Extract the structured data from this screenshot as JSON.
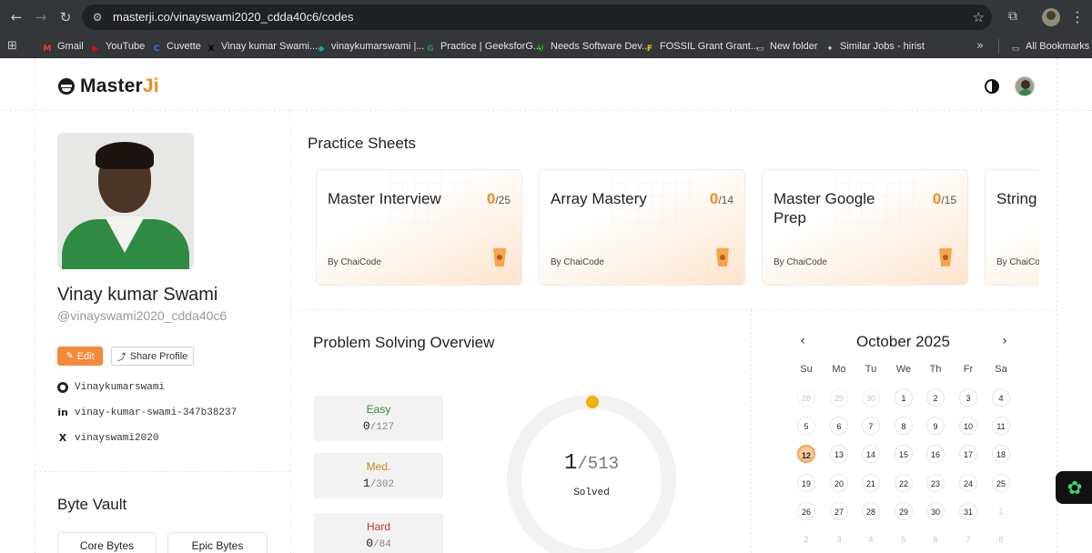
{
  "browser": {
    "url": "masterji.co/vinayswami2020_cdda40c6/codes",
    "bookmarks": [
      {
        "label": "Gmail",
        "icon": "gmail-icon",
        "color": "#ea4335",
        "glyph": "M"
      },
      {
        "label": "YouTube",
        "icon": "youtube-icon",
        "color": "#ff0000",
        "glyph": "▶"
      },
      {
        "label": "Cuvette",
        "icon": "cuvette-icon",
        "color": "#3d6cf0",
        "glyph": "C"
      },
      {
        "label": "Vinay kumar Swami...",
        "icon": "x-icon",
        "color": "#000000",
        "glyph": "X"
      },
      {
        "label": "vinaykumarswami |...",
        "icon": "diamond-icon",
        "color": "#16a7a0",
        "glyph": "◆"
      },
      {
        "label": "Practice | GeeksforG...",
        "icon": "gfg-icon",
        "color": "#2f8d46",
        "glyph": "G"
      },
      {
        "label": "Needs Software Dev...",
        "icon": "upwork-icon",
        "color": "#14a800",
        "glyph": "U"
      },
      {
        "label": "FOSSIL Grant Grant...",
        "icon": "fossil-icon",
        "color": "#f2c811",
        "glyph": "F"
      },
      {
        "label": "New folder",
        "icon": "folder-icon",
        "color": "#c8cacd",
        "glyph": "▭"
      },
      {
        "label": "Similar Jobs - hirist",
        "icon": "runner-icon",
        "color": "#c8cacd",
        "glyph": "✦"
      }
    ],
    "all_bookmarks": "All Bookmarks"
  },
  "header": {
    "logo_main": "Master",
    "logo_accent": "Ji"
  },
  "profile": {
    "name": "Vinay kumar Swami",
    "handle": "@vinayswami2020_cdda40c6",
    "edit_label": "Edit",
    "share_label": "Share Profile",
    "github": "Vinaykumarswami",
    "linkedin": "vinay-kumar-swami-347b38237",
    "x": "vinayswami2020"
  },
  "byte_vault": {
    "title": "Byte Vault",
    "buttons": [
      "Core Bytes",
      "Epic Bytes"
    ]
  },
  "practice": {
    "title": "Practice Sheets",
    "sheets": [
      {
        "title": "Master Interview",
        "done": "0",
        "total": "/25",
        "by": "By ChaiCode"
      },
      {
        "title": "Array Mastery",
        "done": "0",
        "total": "/14",
        "by": "By ChaiCode"
      },
      {
        "title": "Master Google Prep",
        "done": "0",
        "total": "/15",
        "by": "By ChaiCode"
      },
      {
        "title": "String",
        "done": "",
        "total": "",
        "by": "By ChaiCode"
      }
    ]
  },
  "overview": {
    "title": "Problem Solving Overview",
    "difficulties": [
      {
        "label": "Easy",
        "solved": "0",
        "total": "/127",
        "color": "#2e8b3d"
      },
      {
        "label": "Med.",
        "solved": "1",
        "total": "/302",
        "color": "#c98a12"
      },
      {
        "label": "Hard",
        "solved": "0",
        "total": "/84",
        "color": "#c4372c"
      }
    ],
    "solved": "1",
    "total": "/513",
    "solved_label": "Solved",
    "progress_fraction": 0.00195,
    "ring_color": "#f2f2f2",
    "dot_color": "#f2b10c"
  },
  "calendar": {
    "month": "October 2025",
    "weekdays": [
      "Su",
      "Mo",
      "Tu",
      "We",
      "Th",
      "Fr",
      "Sa"
    ],
    "weeks": [
      [
        "28",
        "29",
        "30",
        "1",
        "2",
        "3",
        "4"
      ],
      [
        "5",
        "6",
        "7",
        "8",
        "9",
        "10",
        "11"
      ],
      [
        "12",
        "13",
        "14",
        "15",
        "16",
        "17",
        "18"
      ],
      [
        "19",
        "20",
        "21",
        "22",
        "23",
        "24",
        "25"
      ],
      [
        "26",
        "27",
        "28",
        "29",
        "30",
        "31",
        "1"
      ],
      [
        "2",
        "3",
        "4",
        "5",
        "6",
        "7",
        "8"
      ]
    ],
    "today": "12"
  },
  "colors": {
    "accent": "#f28a1d",
    "edit_button": "#f5893a"
  }
}
